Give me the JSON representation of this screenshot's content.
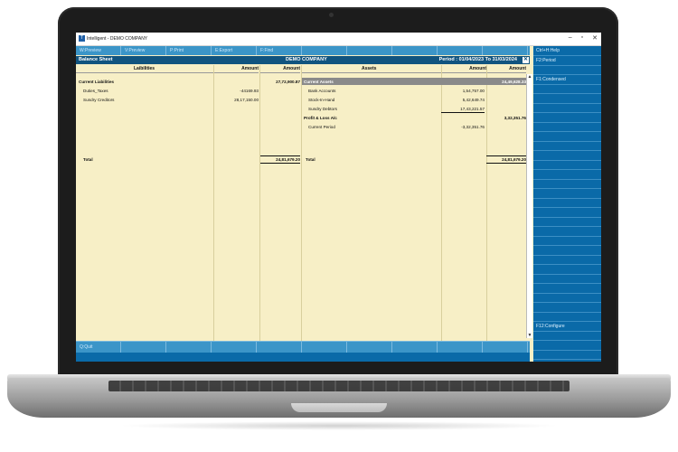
{
  "window": {
    "title": "Intelligent - DEMO COMPANY",
    "app_icon": "T",
    "minimize": "–",
    "maximize": "▫",
    "close": "✕"
  },
  "toolbar": [
    "W:Preview",
    "V:Preview",
    "P:Print",
    "E:Export",
    "F:Find",
    "",
    "",
    "",
    "",
    ""
  ],
  "report": {
    "name": "Balance Sheet",
    "company": "DEMO COMPANY",
    "period": "Period : 01/04/2023 To 31/03/2024",
    "close_box": "✕"
  },
  "columns": {
    "liabilities": "Laibilities",
    "amount1": "Amount",
    "amount2": "Amount",
    "assets": "Assets",
    "amount3": "Amount",
    "amount4": "Amount"
  },
  "liabilities": {
    "group": "Current Liabilities",
    "group_total": "27,72,900.87",
    "items": [
      {
        "name": "Duties_Taxes",
        "amount": "-44169.93"
      },
      {
        "name": "Sundry Creditors",
        "amount": "28,17,150.00"
      }
    ],
    "total_label": "Total",
    "total": "24,81,679.20"
  },
  "assets": {
    "group": "Current Assets",
    "group_total": "24,49,628.33",
    "items": [
      {
        "name": "Bank Accounts",
        "amount": "1,54,757.00"
      },
      {
        "name": "Stock-In-Hand",
        "amount": "5,42,649.74"
      },
      {
        "name": "Sundry Debtors",
        "amount": "17,43,221.57"
      }
    ],
    "pl_group": "Profit & Loss A/c",
    "pl_total": "3,32,351.76",
    "pl_items": [
      {
        "name": "Current Period",
        "amount": "-3,32,351.76"
      }
    ],
    "total_label": "Total",
    "total": "24,81,679.20"
  },
  "sidebar": [
    "Ctrl+H:Help",
    "F2:Period",
    "",
    "F1:Condensed",
    "",
    "",
    "",
    "",
    "",
    "",
    "",
    "",
    "",
    "",
    "",
    "",
    "",
    "",
    "",
    "",
    "",
    "",
    "",
    "",
    "",
    "",
    "",
    "",
    "",
    "F12:Configure",
    "",
    "",
    ""
  ],
  "bottombar": [
    "Q:Quit",
    "",
    "",
    "",
    "",
    "",
    "",
    "",
    "",
    ""
  ]
}
